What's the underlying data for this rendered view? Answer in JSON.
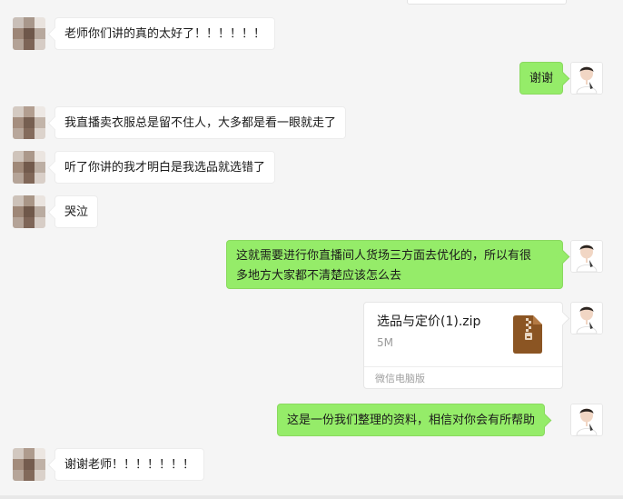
{
  "messages": [
    {
      "from": "other",
      "text": "老师你们讲的真的太好了！！！！！！"
    },
    {
      "from": "self",
      "text": "谢谢"
    },
    {
      "from": "other",
      "text": "我直播卖衣服总是留不住人，大多都是看一眼就走了"
    },
    {
      "from": "other",
      "text": "听了你讲的我才明白是我选品就选错了"
    },
    {
      "from": "other",
      "text": "哭泣"
    },
    {
      "from": "self",
      "text_line1": "这就需要进行你直播间人货场三方面去优化的，所以有很",
      "text_line2": "多地方大家都不清楚应该怎么去"
    },
    {
      "from": "self",
      "type": "file",
      "file_name": "选品与定价(1).zip",
      "file_size": "5M",
      "source": "微信电脑版",
      "icon": "zip-archive-icon"
    },
    {
      "from": "self",
      "text": "这是一份我们整理的资料，相信对你会有所帮助"
    },
    {
      "from": "other",
      "text": "谢谢老师！！！！！！！"
    }
  ],
  "colors": {
    "background": "#f5f5f5",
    "self_bubble": "#95ec69",
    "other_bubble": "#ffffff",
    "zip_icon": "#8b5523"
  }
}
